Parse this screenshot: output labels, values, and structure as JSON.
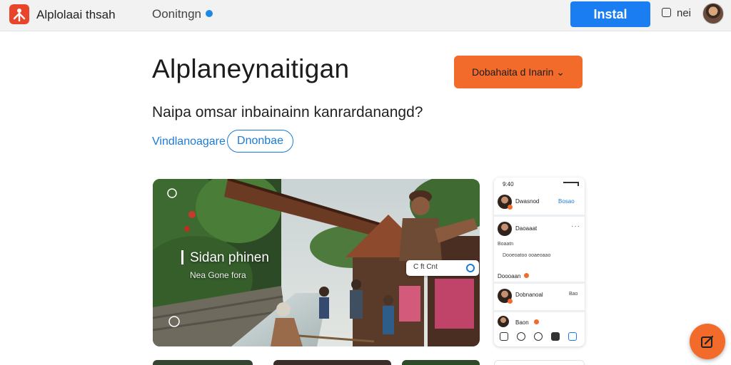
{
  "topbar": {
    "app_name": "Alplolaai thsah",
    "status_label": "Oonitngn",
    "install_label": "Instal",
    "more_label": "nei",
    "colors": {
      "accent": "#1a7ef2",
      "brand": "#e8452c"
    },
    "icons": [
      "logo-icon",
      "online-dot-icon",
      "message-icon",
      "user-avatar"
    ]
  },
  "header": {
    "title": "Alplaneynaitigan",
    "cta_label": "Dobahaita d Inarin ⌄",
    "question": "Naipa omsar inbainainn kanrardanangd?",
    "link_label": "Vindlanoagare",
    "outline_button_label": "Dnonbae"
  },
  "hero": {
    "title": "Sidan phinen",
    "subtitle": "Nea   Gone fora",
    "pill_label": "C  ft  Cnt"
  },
  "phone": {
    "time": "9:40",
    "items": [
      {
        "name": "Dwasnod",
        "link": "Bosao"
      },
      {
        "name": "Daoaaat",
        "sub": "Boaatn",
        "sub2": "Dooeoatoo ooaeoaao"
      },
      {
        "name": "Doooaan"
      },
      {
        "name": "Dobnanoal",
        "meta": "Bao"
      },
      {
        "name": "Baon"
      }
    ],
    "more": "···"
  },
  "fab": {
    "icon": "compose-icon"
  },
  "colors": {
    "orange": "#f26b2b",
    "blue": "#1a7ef2",
    "link": "#1b7bd6"
  }
}
